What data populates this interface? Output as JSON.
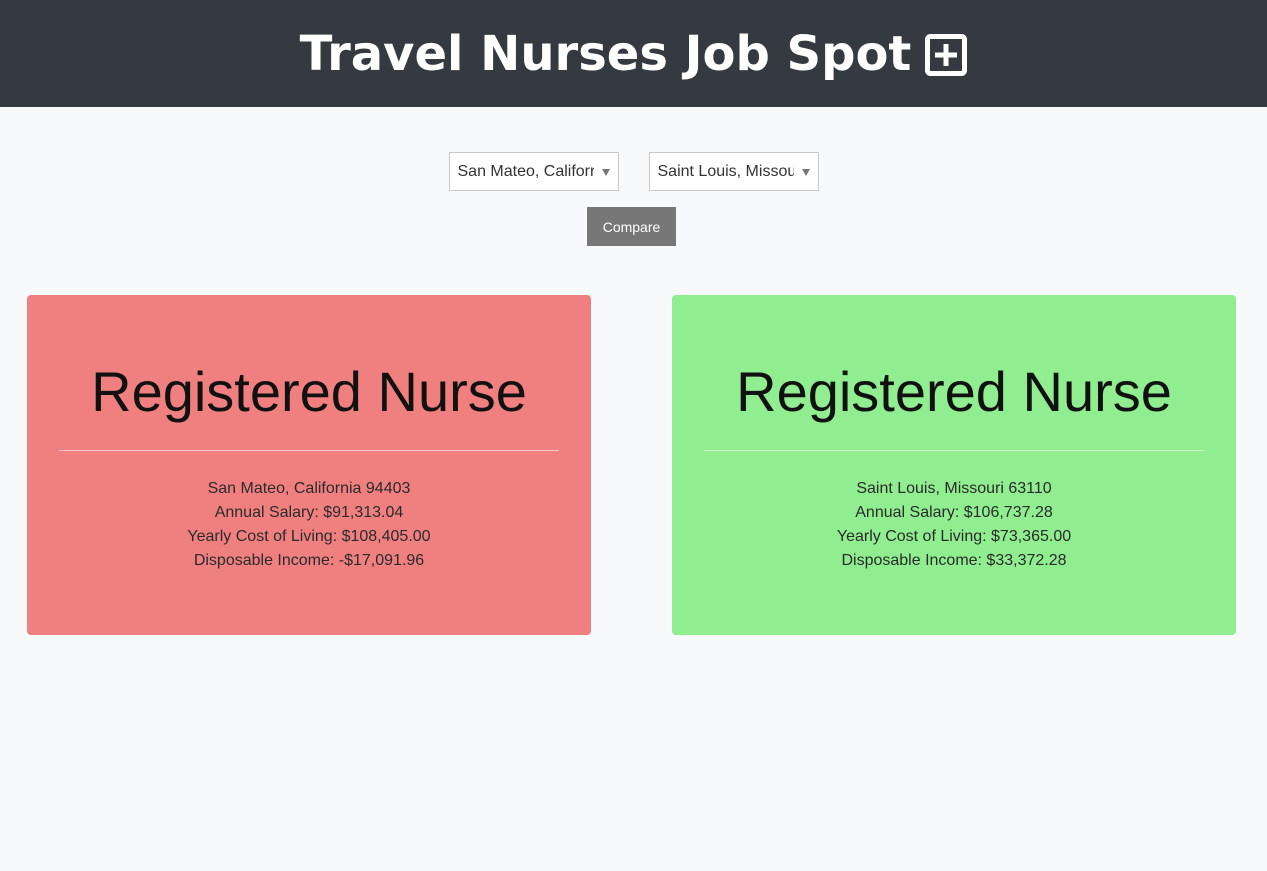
{
  "header": {
    "title": "Travel Nurses Job Spot",
    "icon": "plus-square-icon"
  },
  "controls": {
    "location_a": "San Mateo, California",
    "location_b": "Saint Louis, Missouri",
    "compare_label": "Compare"
  },
  "colors": {
    "header_bg": "#343a40",
    "card_negative": "#f08080",
    "card_positive": "#90ee90",
    "button_bg": "#777777"
  },
  "cards": [
    {
      "title": "Registered Nurse",
      "location": "San Mateo, California 94403",
      "salary": "Annual Salary: $91,313.04",
      "cost": "Yearly Cost of Living: $108,405.00",
      "disposable": "Disposable Income: -$17,091.96"
    },
    {
      "title": "Registered Nurse",
      "location": "Saint Louis, Missouri 63110",
      "salary": "Annual Salary: $106,737.28",
      "cost": "Yearly Cost of Living: $73,365.00",
      "disposable": "Disposable Income: $33,372.28"
    }
  ]
}
